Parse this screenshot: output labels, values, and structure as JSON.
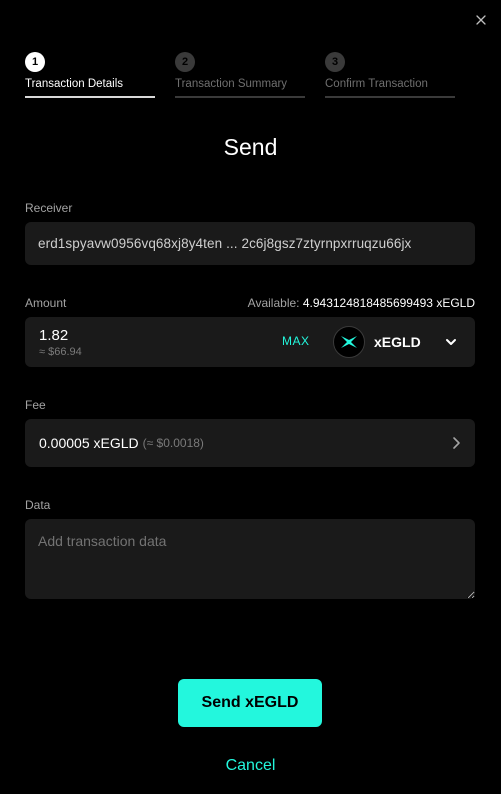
{
  "steps": [
    {
      "number": "1",
      "label": "Transaction Details"
    },
    {
      "number": "2",
      "label": "Transaction Summary"
    },
    {
      "number": "3",
      "label": "Confirm Transaction"
    }
  ],
  "title": "Send",
  "receiver": {
    "label": "Receiver",
    "value": "erd1spyavw0956vq68xj8y4ten ...  2c6j8gsz7ztyrnpxrruqzu66jx"
  },
  "amount": {
    "label": "Amount",
    "available_label": "Available:",
    "available_value": "4.943124818485699493 xEGLD",
    "value": "1.82",
    "usd": "≈ $66.94",
    "max_label": "MAX",
    "token": "xEGLD"
  },
  "fee": {
    "label": "Fee",
    "value": "0.00005 xEGLD",
    "usd": "(≈ $0.0018)"
  },
  "data_field": {
    "label": "Data",
    "placeholder": "Add transaction data"
  },
  "buttons": {
    "send": "Send xEGLD",
    "cancel": "Cancel"
  },
  "colors": {
    "background": "#000000",
    "accent": "#23f7dd",
    "field": "#1a1a1a"
  }
}
